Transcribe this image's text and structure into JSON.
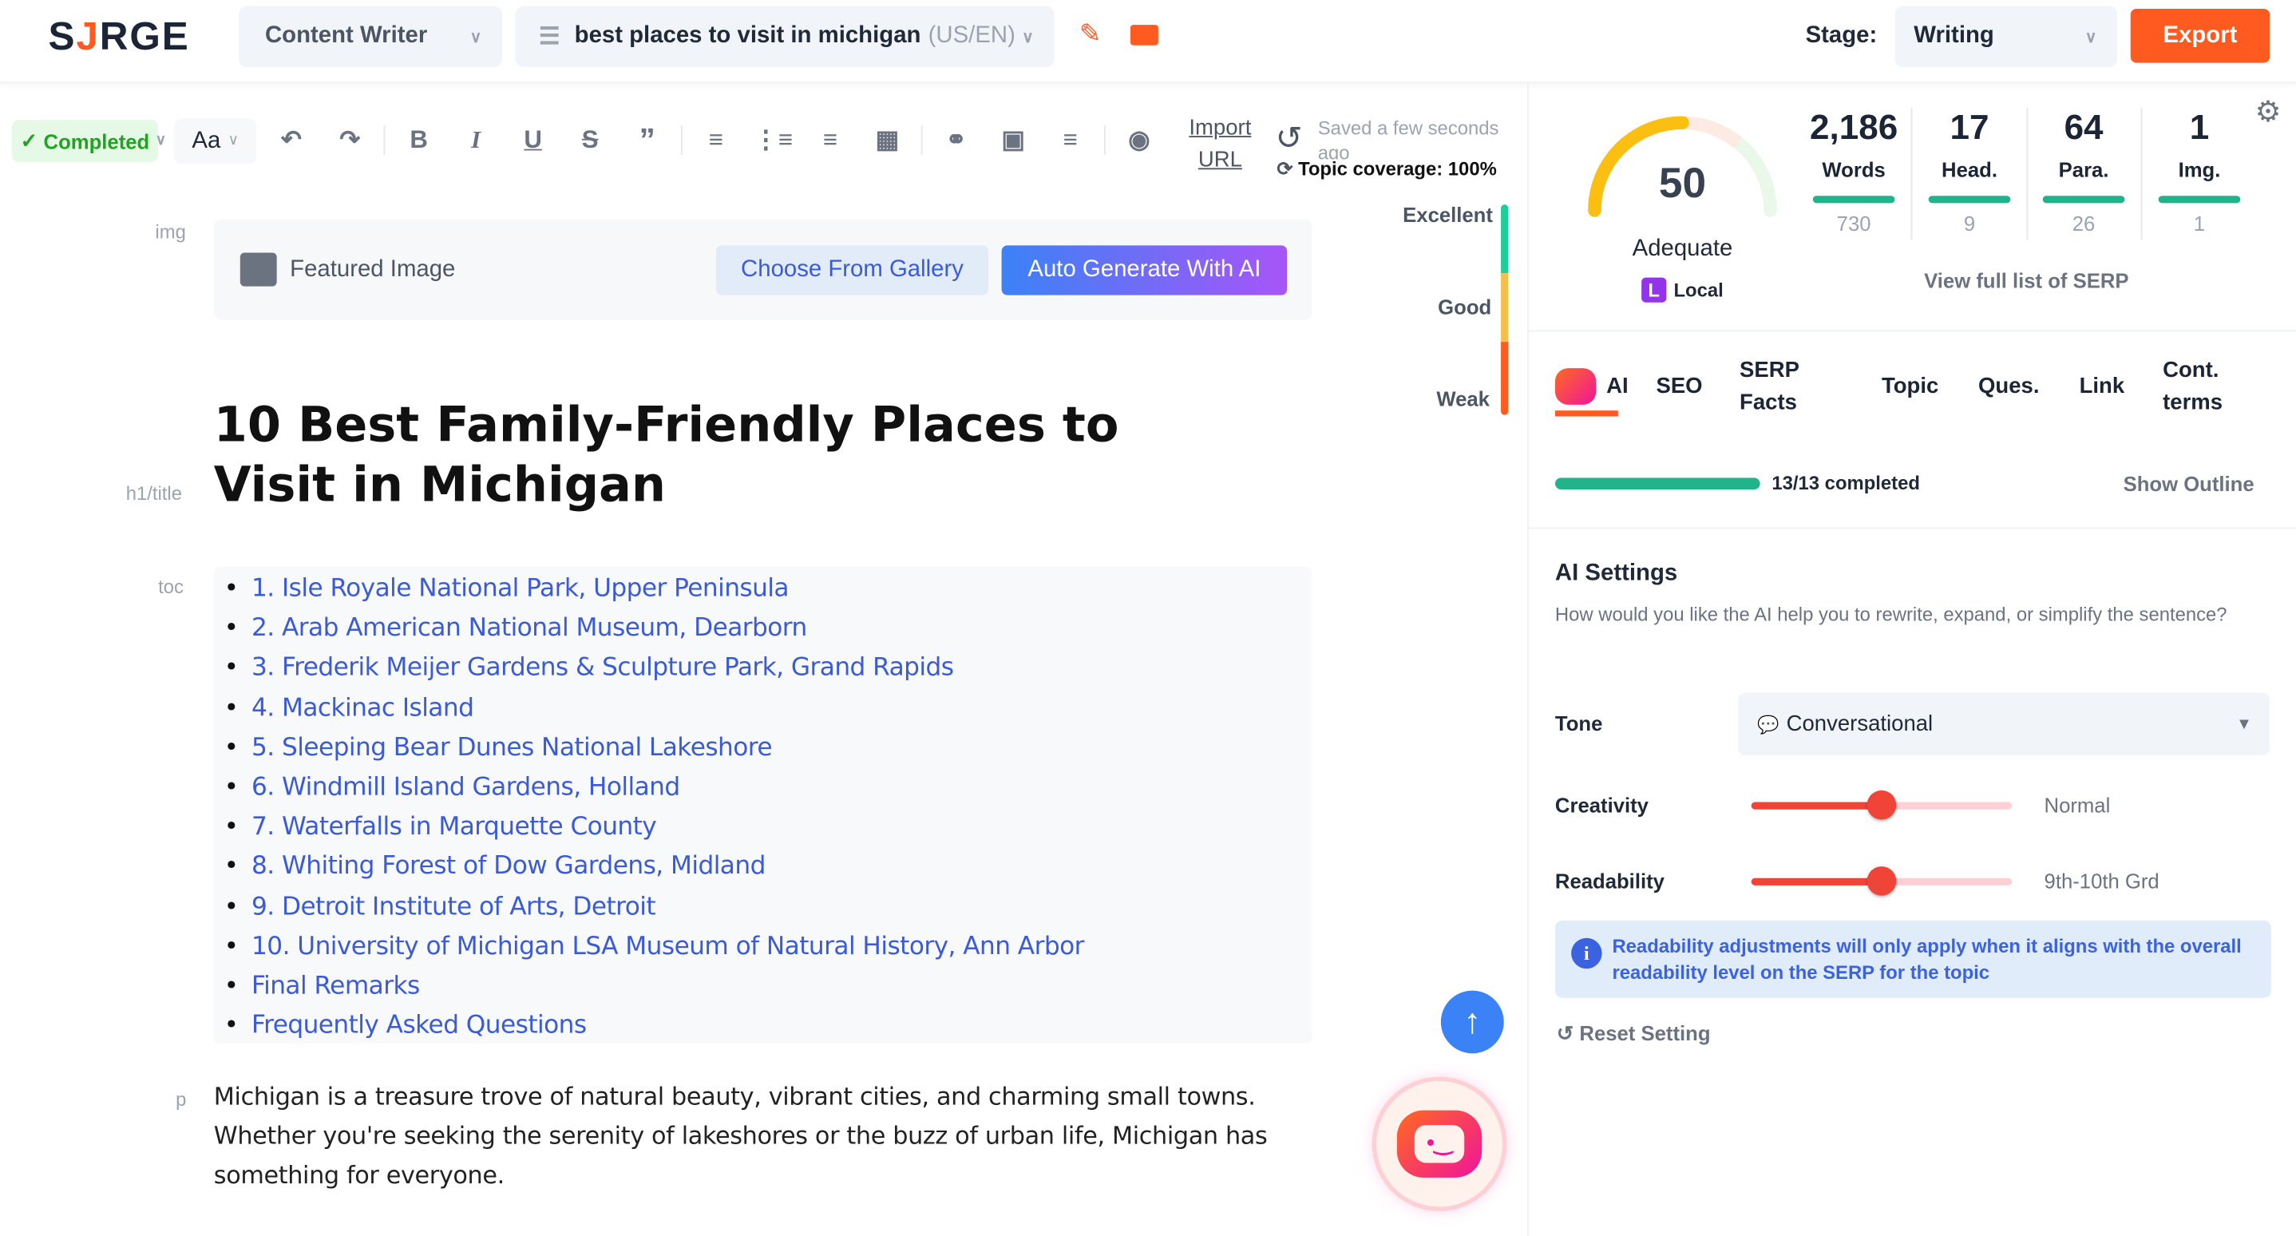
{
  "header": {
    "logo": {
      "pre": "S",
      "mid": "J",
      "post": "RGE"
    },
    "mode_select": "Content Writer",
    "keyword": "best places to visit in michigan",
    "locale": "(US/EN)",
    "stage_label": "Stage:",
    "stage_value": "Writing",
    "export_label": "Export"
  },
  "toolbar": {
    "status": "Completed",
    "font_button": "Aa",
    "import_url": [
      "Import",
      "URL"
    ],
    "saved_text": "Saved a few seconds ago",
    "topic_coverage": "Topic coverage: 100%"
  },
  "editor": {
    "labels": {
      "img": "img",
      "h1": "h1/title",
      "toc": "toc",
      "p": "p"
    },
    "featured_image": "Featured Image",
    "choose_gallery": "Choose From Gallery",
    "auto_generate": "Auto Generate With AI",
    "title": "10 Best Family-Friendly Places to Visit in Michigan",
    "toc": [
      "1. Isle Royale National Park, Upper Peninsula",
      "2. Arab American National Museum, Dearborn",
      "3. Frederik Meijer Gardens & Sculpture Park, Grand Rapids",
      "4. Mackinac Island",
      "5. Sleeping Bear Dunes National Lakeshore",
      "6. Windmill Island Gardens, Holland",
      "7. Waterfalls in Marquette County",
      "8. Whiting Forest of Dow Gardens, Midland",
      "9. Detroit Institute of Arts, Detroit",
      "10. University of Michigan LSA Museum of Natural History, Ann Arbor",
      "Final Remarks",
      "Frequently Asked Questions"
    ],
    "paragraph": "Michigan is a treasure trove of natural beauty, vibrant cities, and charming small towns. Whether you're seeking the serenity of lakeshores or the buzz of urban life, Michigan has something for everyone."
  },
  "quality_scale": {
    "excellent": "Excellent",
    "good": "Good",
    "weak": "Weak"
  },
  "score": {
    "value": "50",
    "value_num": 50,
    "rating": "Adequate",
    "badge_letter": "L",
    "badge_label": "Local"
  },
  "stats": [
    {
      "value": "2,186",
      "label": "Words",
      "target": "730"
    },
    {
      "value": "17",
      "label": "Head.",
      "target": "9"
    },
    {
      "value": "64",
      "label": "Para.",
      "target": "26"
    },
    {
      "value": "1",
      "label": "Img.",
      "target": "1"
    }
  ],
  "serp_link": "View full list of SERP",
  "tabs": [
    {
      "label": "AI",
      "active": true
    },
    {
      "label": "SEO"
    },
    {
      "label": "SERP Facts"
    },
    {
      "label": "Topic"
    },
    {
      "label": "Ques."
    },
    {
      "label": "Link"
    },
    {
      "label": "Cont. terms"
    }
  ],
  "progress": {
    "text": "13/13 completed",
    "fraction": 1.0,
    "show_outline": "Show Outline"
  },
  "ai_settings": {
    "title": "AI Settings",
    "description": "How would you like the AI help you to rewrite, expand, or simplify the sentence?",
    "tone_label": "Tone",
    "tone_value": "Conversational",
    "creativity_label": "Creativity",
    "creativity_value": "Normal",
    "creativity_level": 0.5,
    "readability_label": "Readability",
    "readability_value": "9th-10th Grd",
    "readability_level": 0.5,
    "info": "Readability adjustments will only apply when it aligns with the overall readability level on the SERP for the topic",
    "reset": "Reset Setting"
  },
  "colors": {
    "accent": "#ff5a1f",
    "link": "#3b5bd6",
    "success": "#22b38a",
    "slider": "#f04438"
  }
}
